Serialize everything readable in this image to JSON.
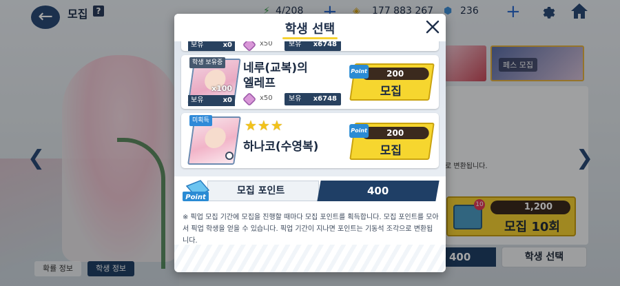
{
  "topbar": {
    "title": "모집",
    "help_icon": "?",
    "ap": "4/208",
    "credits": "177 883 267",
    "gems": "236",
    "icons": [
      "back-arrow-icon",
      "help-icon",
      "ap-icon",
      "credit-icon",
      "gem-icon",
      "plus-icon",
      "gear-icon",
      "home-icon"
    ]
  },
  "background": {
    "banner_label": "페스 모집",
    "note": "로 변환됩니다.",
    "recruit10": {
      "badge": "10",
      "cost": "1,200",
      "label": "모집 10회"
    },
    "point_value": "400",
    "select_button": "학생 선택",
    "tabs": [
      "확률 정보",
      "학생 정보"
    ]
  },
  "modal": {
    "title": "학생 선택",
    "cards": [
      {
        "tag": "학생 보유중",
        "name_line1": "네루(교복)의",
        "name_line2": "엘레프",
        "count": "x100",
        "owned_label": "보유",
        "owned_value": "x0",
        "eleph_mult": "x50",
        "eleph_owned_label": "보유",
        "eleph_owned_value": "x6748",
        "cost": "200",
        "button_label": "모집",
        "point_badge": "Point"
      },
      {
        "tag": "미획득",
        "stars": "★★★",
        "name": "하나코(수영복)",
        "cost": "200",
        "button_label": "모집",
        "point_badge": "Point"
      }
    ],
    "partial_row": {
      "owned_label": "보유",
      "owned_value": "x0",
      "eleph_mult": "x50",
      "eleph_owned_label": "보유",
      "eleph_owned_value": "x6748"
    },
    "point_bar": {
      "logo_text": "Point",
      "label": "모집 포인트",
      "value": "400"
    },
    "notice": "※ 픽업 모집 기간에 모집을 진행할 때마다 모집 포인트를 획득합니다. 모집 포인트를 모아서 픽업 학생을 얻을 수 있습니다. 픽업 기간이 지나면 포인트는 기동석 조각으로 변환됩니다."
  },
  "colors": {
    "navy": "#1f3f66",
    "yellow": "#f6d62f",
    "accent_blue": "#2a8bd4"
  }
}
